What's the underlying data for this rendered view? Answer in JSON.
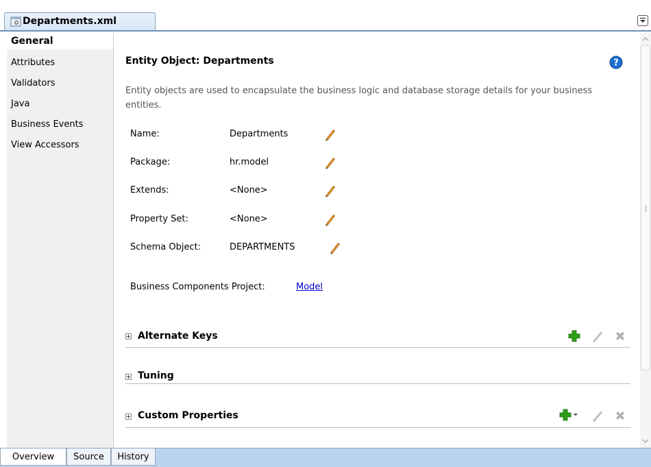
{
  "editor": {
    "tab_title": "Departments.xml"
  },
  "nav": {
    "items": [
      {
        "label": "General",
        "selected": true
      },
      {
        "label": "Attributes",
        "selected": false
      },
      {
        "label": "Validators",
        "selected": false
      },
      {
        "label": "Java",
        "selected": false
      },
      {
        "label": "Business Events",
        "selected": false
      },
      {
        "label": "View Accessors",
        "selected": false
      }
    ]
  },
  "main": {
    "title": "Entity Object: Departments",
    "description": "Entity objects are used to encapsulate the business logic and database storage details for your business entities.",
    "fields": [
      {
        "label": "Name:",
        "value": "Departments"
      },
      {
        "label": "Package:",
        "value": "hr.model"
      },
      {
        "label": "Extends:",
        "value": "<None>"
      },
      {
        "label": "Property Set:",
        "value": "<None>"
      },
      {
        "label": "Schema Object:",
        "value": "DEPARTMENTS"
      }
    ],
    "project_label": "Business Components Project:",
    "project_link": "Model",
    "sections": [
      {
        "title": "Alternate Keys"
      },
      {
        "title": "Tuning"
      },
      {
        "title": "Custom Properties"
      }
    ]
  },
  "bottom_tabs": [
    {
      "label": "Overview"
    },
    {
      "label": "Source"
    },
    {
      "label": "History"
    }
  ],
  "colors": {
    "tab_border": "#7f9db9",
    "nav_bg": "#f0f0f0",
    "link": "#0000cc",
    "add_green": "#2e9e1a",
    "help_blue": "#1e6fd0",
    "pencil_orange": "#e07a10",
    "bottom_bar": "#bcd3ee"
  },
  "icons": {
    "tab": "entity-object-icon",
    "help": "help-icon",
    "edit": "pencil-icon",
    "add": "add-icon",
    "delete": "delete-icon",
    "expand": "plus-expander-icon"
  }
}
